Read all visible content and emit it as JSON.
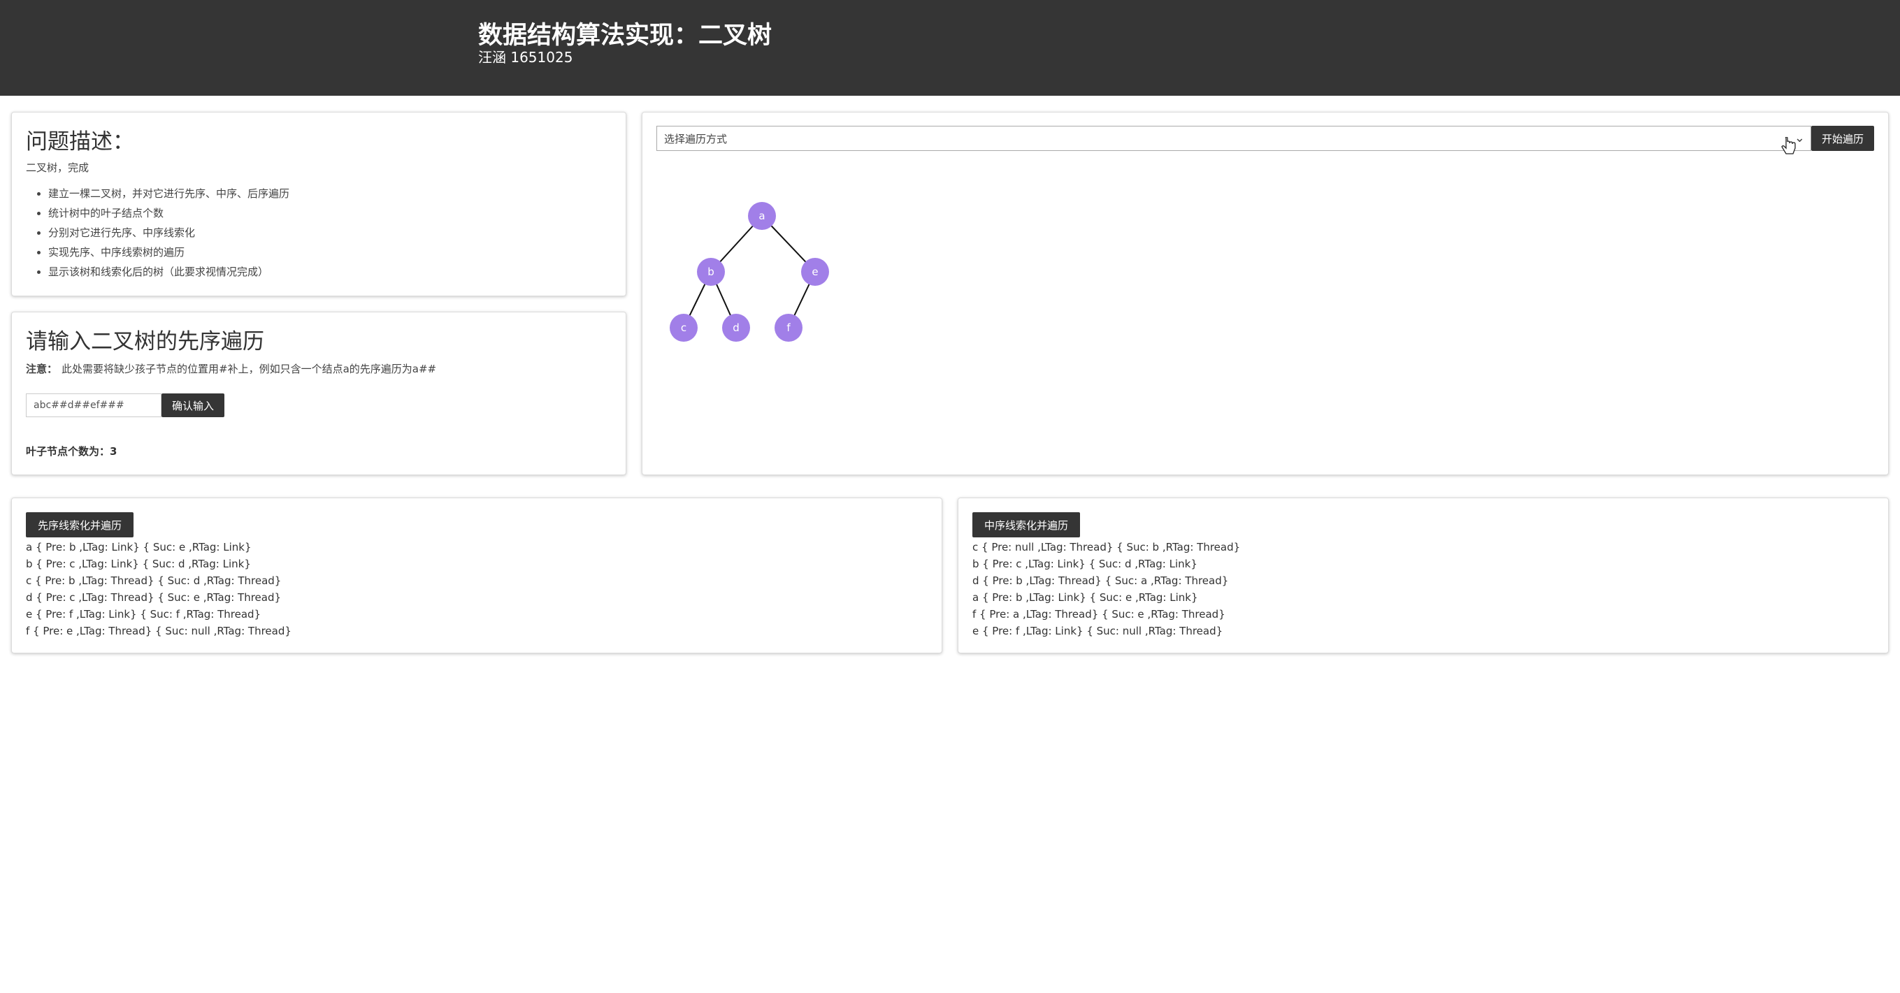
{
  "header": {
    "title": "数据结构算法实现：二叉树",
    "subtitle": "汪涵 1651025"
  },
  "problem": {
    "heading": "问题描述：",
    "intro": "二叉树，完成",
    "items": [
      "建立一棵二叉树，并对它进行先序、中序、后序遍历",
      "统计树中的叶子结点个数",
      "分别对它进行先序、中序线索化",
      "实现先序、中序线索树的遍历",
      "显示该树和线索化后的树（此要求视情况完成）"
    ]
  },
  "input_panel": {
    "heading": "请输入二叉树的先序遍历",
    "note_label": "注意：",
    "note_text": "此处需要将缺少孩子节点的位置用#补上，例如只含一个结点a的先序遍历为a##",
    "input_value": "abc##d##ef###",
    "confirm_label": "确认输入",
    "leaf_label": "叶子节点个数为：3"
  },
  "tree_panel": {
    "select_placeholder": "选择遍历方式",
    "start_label": "开始遍历",
    "node_color": "#a17fe8",
    "nodes": [
      {
        "id": "a",
        "label": "a"
      },
      {
        "id": "b",
        "label": "b"
      },
      {
        "id": "e",
        "label": "e"
      },
      {
        "id": "c",
        "label": "c"
      },
      {
        "id": "d",
        "label": "d"
      },
      {
        "id": "f",
        "label": "f"
      }
    ],
    "edges": [
      [
        "a",
        "b"
      ],
      [
        "a",
        "e"
      ],
      [
        "b",
        "c"
      ],
      [
        "b",
        "d"
      ],
      [
        "e",
        "f"
      ]
    ]
  },
  "preorder_panel": {
    "button": "先序线索化并遍历",
    "lines": [
      "a { Pre: b ,LTag: Link} { Suc: e ,RTag: Link}",
      "b { Pre: c ,LTag: Link} { Suc: d ,RTag: Link}",
      "c { Pre: b ,LTag: Thread} { Suc: d ,RTag: Thread}",
      "d { Pre: c ,LTag: Thread} { Suc: e ,RTag: Thread}",
      "e { Pre: f ,LTag: Link} { Suc: f ,RTag: Thread}",
      "f { Pre: e ,LTag: Thread} { Suc: null ,RTag: Thread}"
    ]
  },
  "inorder_panel": {
    "button": "中序线索化并遍历",
    "lines": [
      "c { Pre: null ,LTag: Thread} { Suc: b ,RTag: Thread}",
      "b { Pre: c ,LTag: Link} { Suc: d ,RTag: Link}",
      "d { Pre: b ,LTag: Thread} { Suc: a ,RTag: Thread}",
      "a { Pre: b ,LTag: Link} { Suc: e ,RTag: Link}",
      "f { Pre: a ,LTag: Thread} { Suc: e ,RTag: Thread}",
      "e { Pre: f ,LTag: Link} { Suc: null ,RTag: Thread}"
    ]
  }
}
